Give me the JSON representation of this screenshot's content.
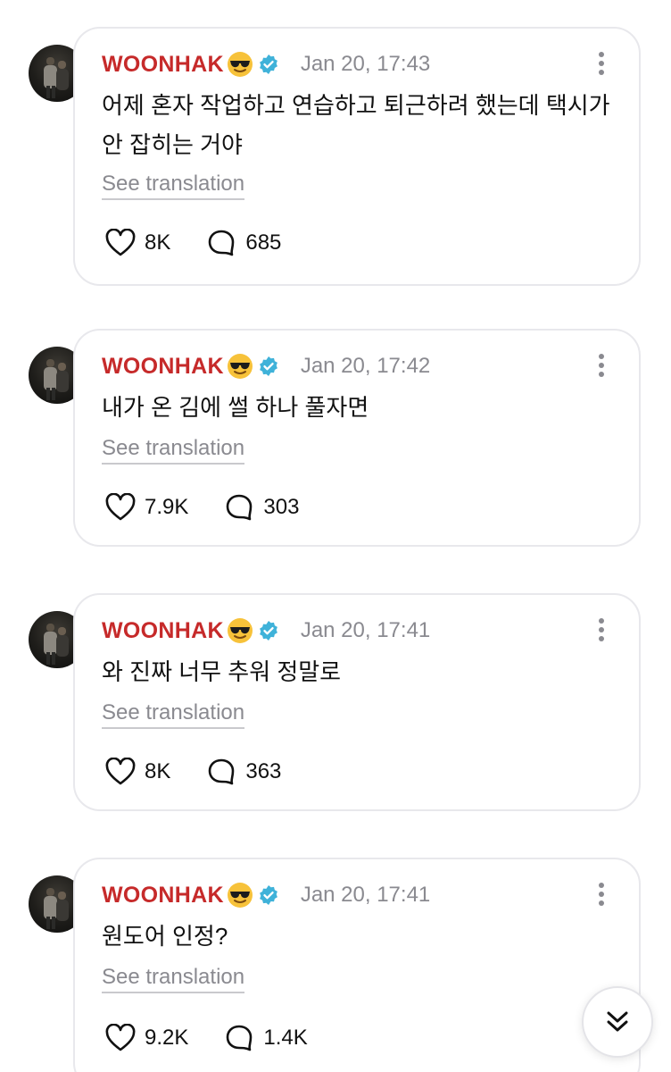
{
  "icons": {
    "emoji": "smiling-face-with-sunglasses",
    "verified": "verified-check-badge",
    "like": "heart-outline",
    "reply": "speech-bubble-outline",
    "more": "vertical-ellipsis",
    "scroll": "double-chevron-down"
  },
  "colors": {
    "username": "#c62a2a",
    "verified_badge": "#3fb2d9",
    "muted_text": "#8a8a90"
  },
  "posts": [
    {
      "username": "WOONHAK",
      "timestamp": "Jan 20, 17:43",
      "text": "어제 혼자 작업하고 연습하고 퇴근하려 했는데 택시가 안 잡히는 거야",
      "translate_label": "See translation",
      "likes": "8K",
      "replies": "685"
    },
    {
      "username": "WOONHAK",
      "timestamp": "Jan 20, 17:42",
      "text": "내가 온 김에 썰 하나 풀자면",
      "translate_label": "See translation",
      "likes": "7.9K",
      "replies": "303"
    },
    {
      "username": "WOONHAK",
      "timestamp": "Jan 20, 17:41",
      "text": "와 진짜 너무 추워 정말로",
      "translate_label": "See translation",
      "likes": "8K",
      "replies": "363"
    },
    {
      "username": "WOONHAK",
      "timestamp": "Jan 20, 17:41",
      "text": "원도어 인정?",
      "translate_label": "See translation",
      "likes": "9.2K",
      "replies": "1.4K"
    }
  ]
}
